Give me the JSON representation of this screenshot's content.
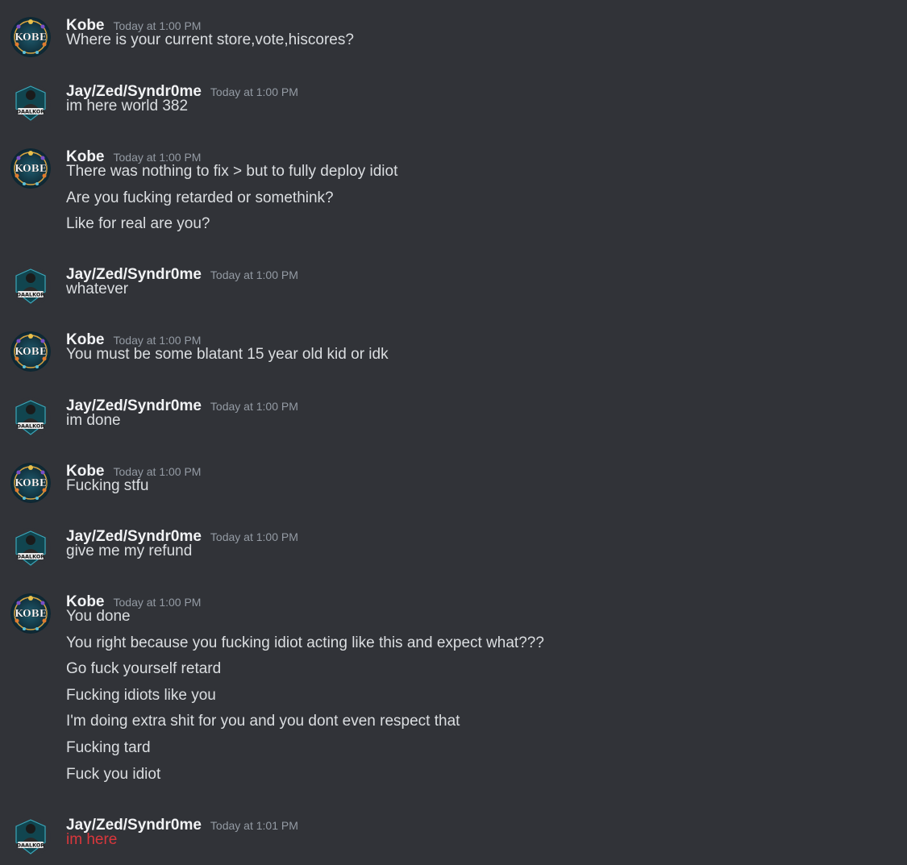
{
  "messages": [
    {
      "author": "Kobe",
      "avatar": "kobe-avatar",
      "timestamp": "Today at 1:00 PM",
      "lines": [
        {
          "text": "Where is your current store,vote,hiscores?"
        }
      ]
    },
    {
      "author": "Jay/Zed/Syndr0me",
      "avatar": "daalkor-avatar",
      "timestamp": "Today at 1:00 PM",
      "lines": [
        {
          "text": "im here world 382"
        }
      ]
    },
    {
      "author": "Kobe",
      "avatar": "kobe-avatar",
      "timestamp": "Today at 1:00 PM",
      "lines": [
        {
          "text": "There was nothing to fix > but to fully deploy idiot"
        },
        {
          "text": "Are you fucking retarded or somethink?"
        },
        {
          "text": "Like for real are you?"
        }
      ]
    },
    {
      "author": "Jay/Zed/Syndr0me",
      "avatar": "daalkor-avatar",
      "timestamp": "Today at 1:00 PM",
      "lines": [
        {
          "text": "whatever"
        }
      ]
    },
    {
      "author": "Kobe",
      "avatar": "kobe-avatar",
      "timestamp": "Today at 1:00 PM",
      "lines": [
        {
          "text": "You must be some blatant 15 year old kid or idk"
        }
      ]
    },
    {
      "author": "Jay/Zed/Syndr0me",
      "avatar": "daalkor-avatar",
      "timestamp": "Today at 1:00 PM",
      "lines": [
        {
          "text": "im done"
        }
      ]
    },
    {
      "author": "Kobe",
      "avatar": "kobe-avatar",
      "timestamp": "Today at 1:00 PM",
      "lines": [
        {
          "text": "Fucking stfu"
        }
      ]
    },
    {
      "author": "Jay/Zed/Syndr0me",
      "avatar": "daalkor-avatar",
      "timestamp": "Today at 1:00 PM",
      "lines": [
        {
          "text": "give me my refund"
        }
      ]
    },
    {
      "author": "Kobe",
      "avatar": "kobe-avatar",
      "timestamp": "Today at 1:00 PM",
      "lines": [
        {
          "text": "You done"
        },
        {
          "text": "You right because you fucking idiot acting like this and expect what???"
        },
        {
          "text": "Go fuck yourself retard"
        },
        {
          "text": "Fucking idiots like you"
        },
        {
          "text": "I'm doing extra shit for you and you dont even respect that"
        },
        {
          "text": "Fucking tard"
        },
        {
          "text": "Fuck you idiot"
        }
      ]
    },
    {
      "author": "Jay/Zed/Syndr0me",
      "avatar": "daalkor-avatar",
      "timestamp": "Today at 1:01 PM",
      "lines": [
        {
          "text": "im here",
          "failed": true
        }
      ]
    }
  ],
  "colors": {
    "background": "#313338",
    "author": "#f2f3f5",
    "timestamp": "#949ba4",
    "text": "#dbdee1",
    "failed_text": "#da373c"
  },
  "avatars": {
    "kobe-avatar": {
      "label": "KOBE"
    },
    "daalkor-avatar": {
      "label": "DAALKOR"
    }
  }
}
